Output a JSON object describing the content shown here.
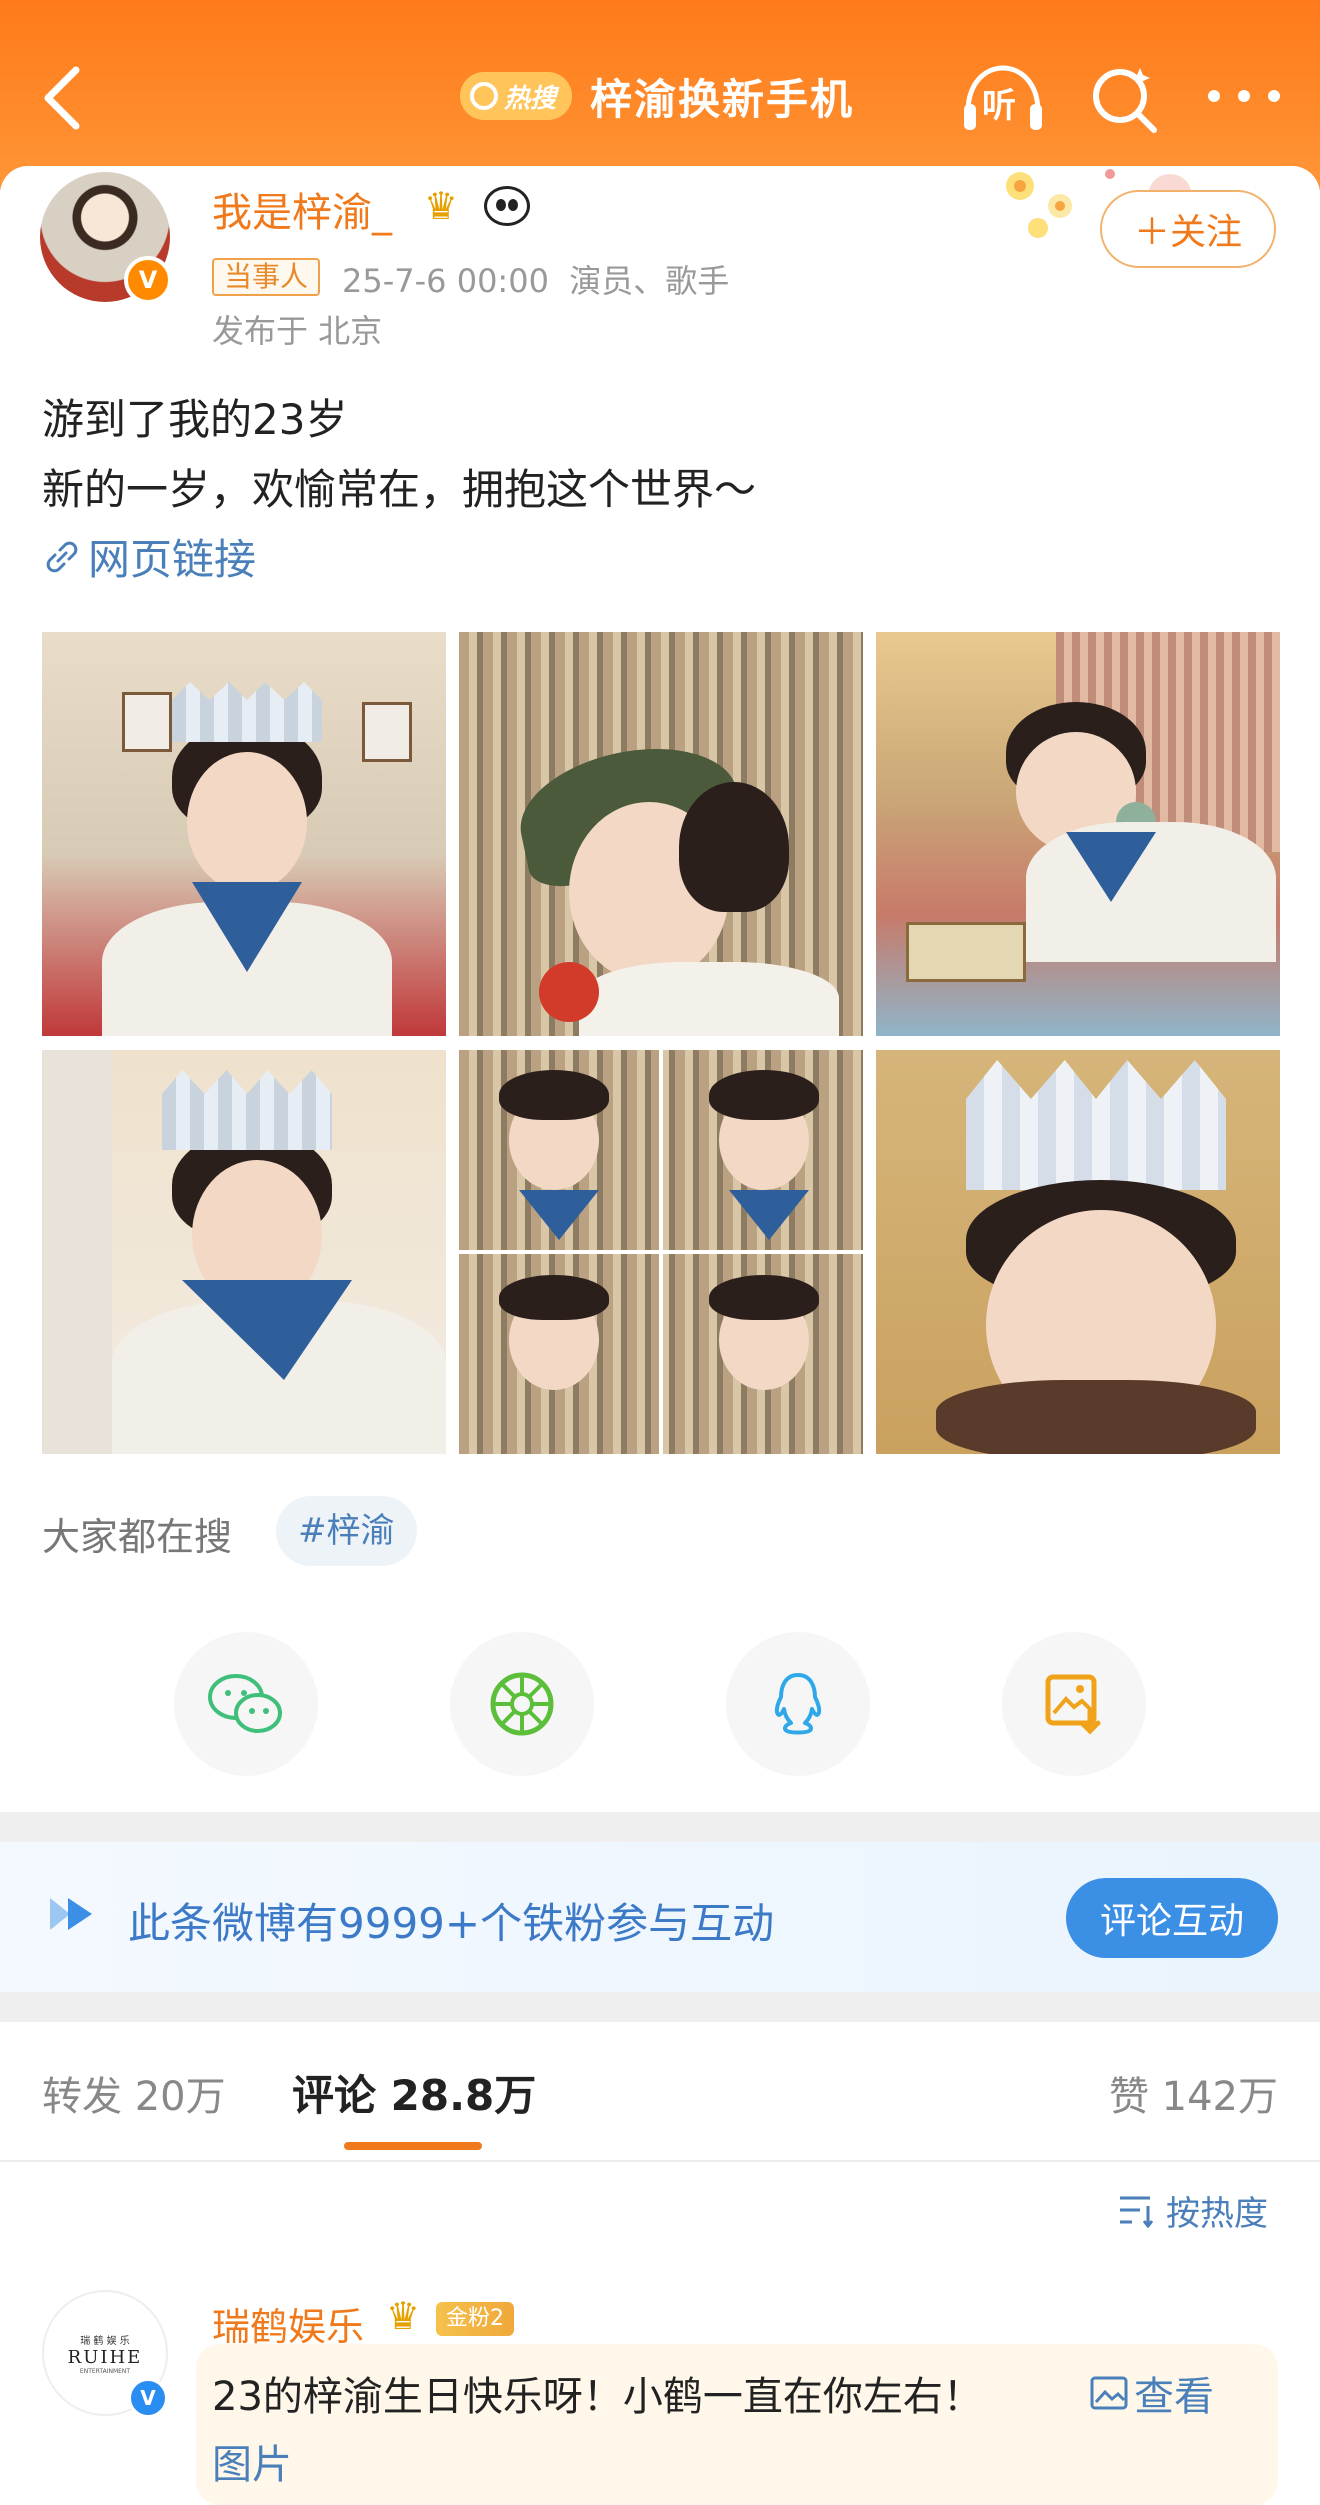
{
  "header": {
    "hot_badge": "热搜",
    "hot_title": "梓渝换新手机",
    "listen_label": "听"
  },
  "post": {
    "author": {
      "name": "我是梓渝_",
      "party_tag": "当事人",
      "datetime": "25-7-6 00:00",
      "role": "演员、歌手",
      "location": "发布于 北京"
    },
    "follow_label": "＋关注",
    "text_lines": [
      "游到了我的23岁",
      "新的一岁，欢愉常在，拥抱这个世界～"
    ],
    "link_label": "网页链接",
    "images_count": 6,
    "search_label": "大家都在搜",
    "topic": "#梓渝"
  },
  "share": [
    "wechat-icon",
    "moments-icon",
    "qq-icon",
    "save-image-icon"
  ],
  "fan_banner": {
    "text": "此条微博有9999+个铁粉参与互动",
    "button": "评论互动"
  },
  "tabs": {
    "repost": "转发 20万",
    "comment": "评论 28.8万",
    "like": "赞 142万"
  },
  "sort_label": "按热度",
  "comment": {
    "avatar_line1": "瑞 鹤 娱 乐",
    "avatar_line2": "RUIHE",
    "avatar_line3": "ENTERTAINMENT",
    "name": "瑞鹤娱乐",
    "fan_badge": "金粉2",
    "text": "23的梓渝生日快乐呀！小鹤一直在你左右！",
    "view_label": "查看",
    "text2": "图片"
  },
  "colors": {
    "brand_orange": "#ff7a1a",
    "link_blue": "#4a7fba",
    "name_orange": "#f07a1b"
  }
}
